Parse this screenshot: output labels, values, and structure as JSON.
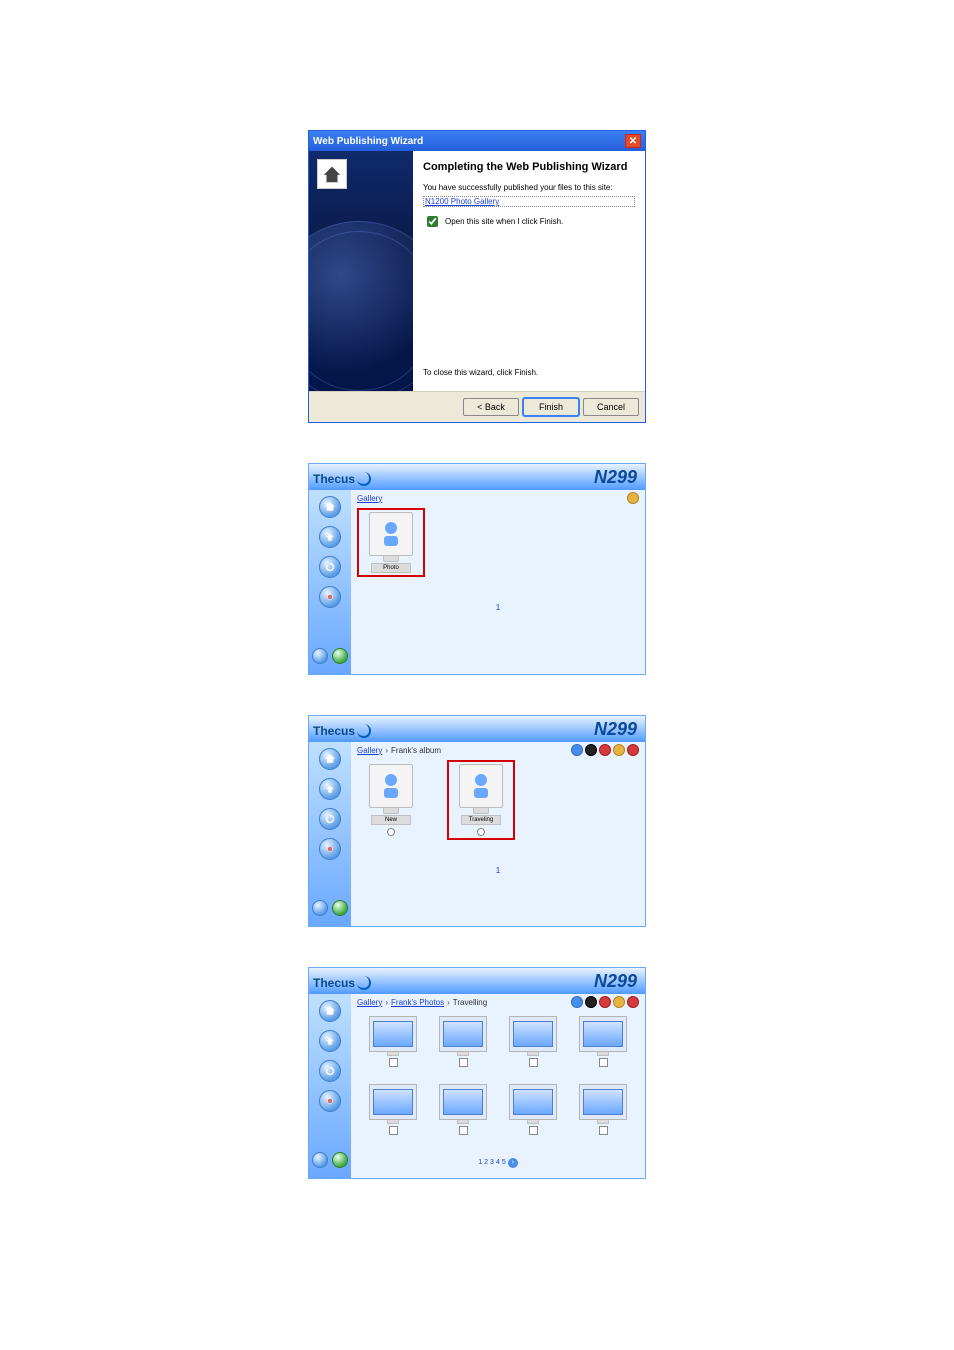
{
  "wizard": {
    "title": "Web Publishing Wizard",
    "heading": "Completing the Web Publishing Wizard",
    "desc": "You have successfully published your files to this site:",
    "site_link": "N1200 Photo Gallery",
    "checkbox_label": "Open this site when I click Finish.",
    "footer": "To close this wizard, click Finish.",
    "buttons": {
      "back": "< Back",
      "finish": "Finish",
      "cancel": "Cancel"
    }
  },
  "thecus1": {
    "brand": "Thecus",
    "model": "N299",
    "crumbs": {
      "path": [
        "Gallery"
      ]
    },
    "albums": [
      {
        "name": "Photo"
      }
    ],
    "page": "1"
  },
  "thecus2": {
    "brand": "Thecus",
    "model": "N299",
    "crumbs": {
      "path": [
        "Gallery",
        "Frank's album"
      ]
    },
    "albums": [
      {
        "name": "New"
      },
      {
        "name": "Traveling"
      }
    ],
    "page": "1"
  },
  "thecus3": {
    "brand": "Thecus",
    "model": "N299",
    "crumbs": {
      "path": [
        "Gallery",
        "Frank's Photos",
        "Travelling"
      ]
    },
    "thumb_count": 8,
    "pager": [
      "1",
      "2",
      "3",
      "4",
      "5"
    ]
  }
}
